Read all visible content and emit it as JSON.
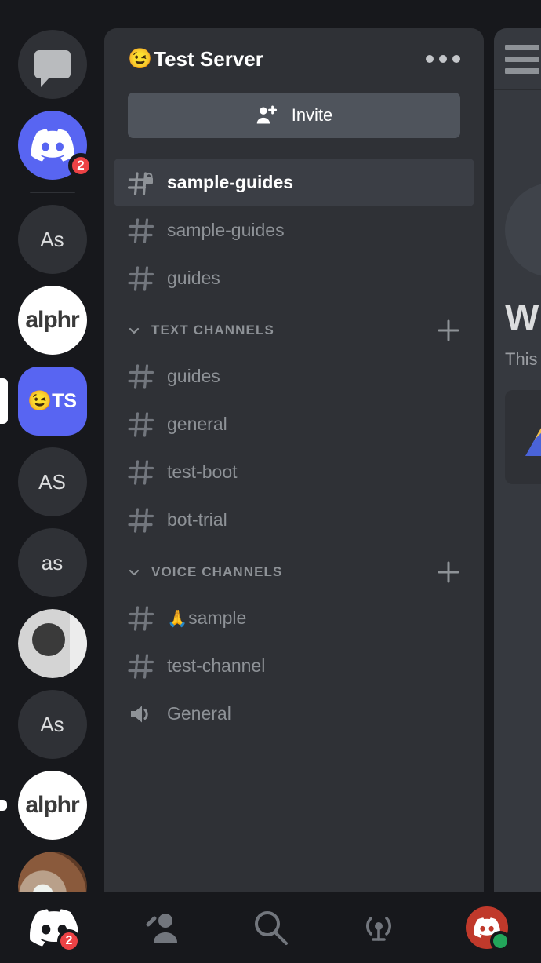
{
  "app": {
    "name": "Discord",
    "theme_bg": "#17181c",
    "panel_bg": "#2f3136",
    "accent": "#5865f2",
    "danger": "#ed4245",
    "online": "#23a55a"
  },
  "server_rail": {
    "name": "server-rail",
    "items": [
      {
        "id": "direct-messages",
        "type": "dm",
        "label": "Direct Messages",
        "icon": "chat-bubble-icon",
        "shape": "circle",
        "style": "dark",
        "badge": null,
        "active": false,
        "unread": false
      },
      {
        "id": "discord-home",
        "type": "server",
        "label": "Discord",
        "icon": "discord-logo-icon",
        "shape": "circle",
        "style": "blurple",
        "badge": "2",
        "active": false,
        "unread": false
      },
      {
        "id": "server-as-1",
        "type": "server",
        "label": "As",
        "icon": null,
        "shape": "circle",
        "style": "dark",
        "badge": null,
        "active": false,
        "unread": false
      },
      {
        "id": "server-alphr-1",
        "type": "server",
        "label": "alphr",
        "icon": null,
        "shape": "circle",
        "style": "white",
        "badge": null,
        "active": false,
        "unread": false
      },
      {
        "id": "server-test-server",
        "type": "server",
        "label": "TS",
        "emoji": "😉",
        "icon": null,
        "shape": "square",
        "style": "blurple",
        "badge": null,
        "active": true,
        "unread": false
      },
      {
        "id": "server-as-2",
        "type": "server",
        "label": "AS",
        "icon": null,
        "shape": "circle",
        "style": "dark",
        "badge": null,
        "active": false,
        "unread": false
      },
      {
        "id": "server-as-3",
        "type": "server",
        "label": "as",
        "icon": null,
        "shape": "circle",
        "style": "dark",
        "badge": null,
        "active": false,
        "unread": false
      },
      {
        "id": "server-a-logo",
        "type": "server",
        "label": "a",
        "icon": "a-logo-icon",
        "shape": "circle",
        "style": "logo",
        "badge": null,
        "active": false,
        "unread": false
      },
      {
        "id": "server-as-4",
        "type": "server",
        "label": "As",
        "icon": null,
        "shape": "circle",
        "style": "dark",
        "badge": null,
        "active": false,
        "unread": false
      },
      {
        "id": "server-alphr-2",
        "type": "server",
        "label": "alphr",
        "icon": null,
        "shape": "circle",
        "style": "white",
        "badge": null,
        "active": false,
        "unread": true
      },
      {
        "id": "server-photo",
        "type": "server",
        "label": "",
        "icon": "photo-avatar-icon",
        "shape": "circle",
        "style": "photo",
        "badge": null,
        "active": false,
        "unread": false
      }
    ]
  },
  "panel": {
    "header": {
      "emoji": "😉",
      "title": "Test Server",
      "more_menu": "more-options"
    },
    "invite": {
      "label": "Invite",
      "icon": "person-add-icon"
    },
    "top_channels": [
      {
        "name": "sample-guides",
        "icon": "hash-lock-icon",
        "private": true,
        "active": true,
        "type": "text"
      },
      {
        "name": "sample-guides",
        "icon": "hash-icon",
        "private": false,
        "active": false,
        "type": "text"
      },
      {
        "name": "guides",
        "icon": "hash-icon",
        "private": false,
        "active": false,
        "type": "text"
      }
    ],
    "categories": [
      {
        "label": "TEXT CHANNELS",
        "collapse_icon": "chevron-down-icon",
        "add_icon": "plus-icon",
        "channels": [
          {
            "name": "guides",
            "icon": "hash-icon",
            "emoji": "",
            "type": "text"
          },
          {
            "name": "general",
            "icon": "hash-icon",
            "emoji": "",
            "type": "text"
          },
          {
            "name": "test-boot",
            "icon": "hash-icon",
            "emoji": "",
            "type": "text"
          },
          {
            "name": "bot-trial",
            "icon": "hash-icon",
            "emoji": "",
            "type": "text"
          }
        ]
      },
      {
        "label": "VOICE CHANNELS",
        "collapse_icon": "chevron-down-icon",
        "add_icon": "plus-icon",
        "channels": [
          {
            "name": "sample",
            "icon": "hash-icon",
            "emoji": "🙏",
            "type": "text"
          },
          {
            "name": "test-channel",
            "icon": "hash-icon",
            "emoji": "",
            "type": "text"
          },
          {
            "name": "General",
            "icon": "speaker-icon",
            "emoji": "",
            "type": "voice"
          }
        ]
      }
    ]
  },
  "peek_panel": {
    "menu_icon": "hamburger-menu-icon",
    "heading": "W",
    "subtext": "This",
    "card": "attachment-thumbnail"
  },
  "bottom_nav": [
    {
      "id": "nav-home",
      "label": "Home",
      "icon": "discord-home-icon",
      "active": true,
      "badge": "2"
    },
    {
      "id": "nav-friends",
      "label": "Friends",
      "icon": "friends-icon",
      "active": false,
      "badge": null
    },
    {
      "id": "nav-search",
      "label": "Search",
      "icon": "search-icon",
      "active": false,
      "badge": null
    },
    {
      "id": "nav-mentions",
      "label": "Mentions",
      "icon": "mentions-icon",
      "active": false,
      "badge": null
    },
    {
      "id": "nav-profile",
      "label": "You",
      "icon": "user-avatar-icon",
      "active": false,
      "badge": null,
      "status": "online"
    }
  ]
}
